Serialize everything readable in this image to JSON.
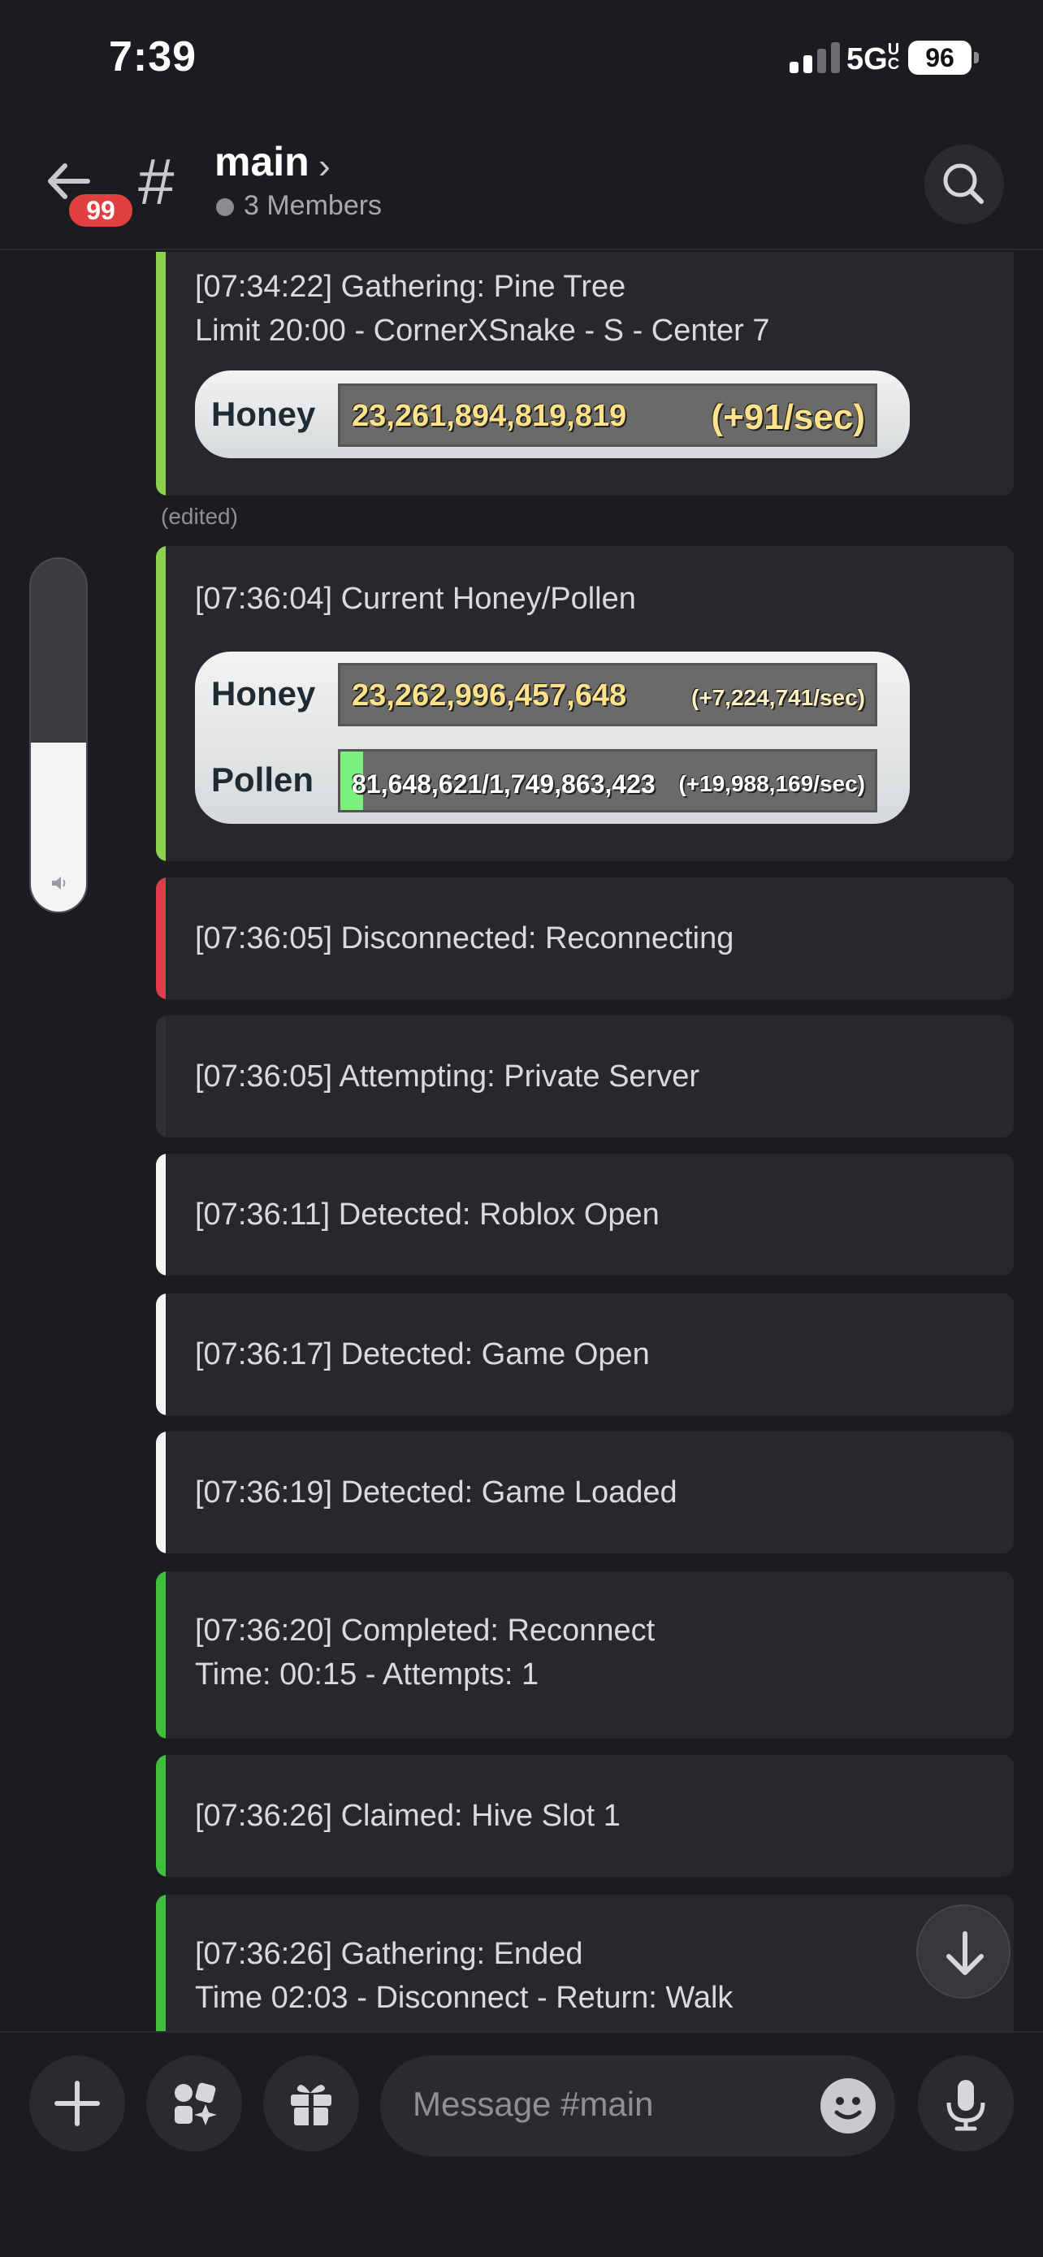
{
  "status_bar": {
    "time": "7:39",
    "network": "5G",
    "network_suffix": "UC",
    "battery": "96"
  },
  "header": {
    "channel_name": "main",
    "members": "3 Members",
    "unread_badge": "99"
  },
  "messages": [
    {
      "lines": [
        "[07:34:22] Gathering: Pine Tree",
        "Limit 20:00 - CornerXSnake - S - Center 7"
      ],
      "accent": "#8bd34f",
      "stats": [
        {
          "label": "Honey",
          "value": "23,261,894,819,819",
          "rate": "(+91/sec)"
        }
      ]
    },
    {
      "edited": "(edited)"
    },
    {
      "lines": [
        "[07:36:04] Current Honey/Pollen"
      ],
      "accent": "#8bd34f",
      "stats": [
        {
          "label": "Honey",
          "value": "23,262,996,457,648",
          "rate": "(+7,224,741/sec)"
        },
        {
          "label": "Pollen",
          "value": "81,648,621/1,749,863,423",
          "rate": "(+19,988,169/sec)"
        }
      ]
    },
    {
      "lines": [
        "[07:36:05] Disconnected: Reconnecting"
      ],
      "accent": "#e23b4a"
    },
    {
      "lines": [
        "[07:36:05] Attempting: Private Server"
      ],
      "accent": "#2f3035"
    },
    {
      "lines": [
        "[07:36:11] Detected: Roblox Open"
      ],
      "accent": "#f4f4f5"
    },
    {
      "lines": [
        "[07:36:17] Detected: Game Open"
      ],
      "accent": "#f4f4f5"
    },
    {
      "lines": [
        "[07:36:19] Detected: Game Loaded"
      ],
      "accent": "#f4f4f5"
    },
    {
      "lines": [
        "[07:36:20] Completed: Reconnect",
        "Time: 00:15 - Attempts: 1"
      ],
      "accent": "#3fbf3a"
    },
    {
      "lines": [
        "[07:36:26] Claimed: Hive Slot 1"
      ],
      "accent": "#3fbf3a"
    },
    {
      "lines": [
        "[07:36:26] Gathering: Ended",
        "Time 02:03 - Disconnect - Return: Walk"
      ],
      "accent": "#3fbf3a"
    }
  ],
  "composer": {
    "placeholder": "Message #main"
  },
  "volume_level": 0.48,
  "icons": [
    "back-arrow-icon",
    "hash-icon",
    "chevron-right-icon",
    "search-icon",
    "plus-icon",
    "apps-icon",
    "gift-icon",
    "emoji-icon",
    "mic-icon",
    "arrow-down-icon",
    "speaker-icon"
  ]
}
